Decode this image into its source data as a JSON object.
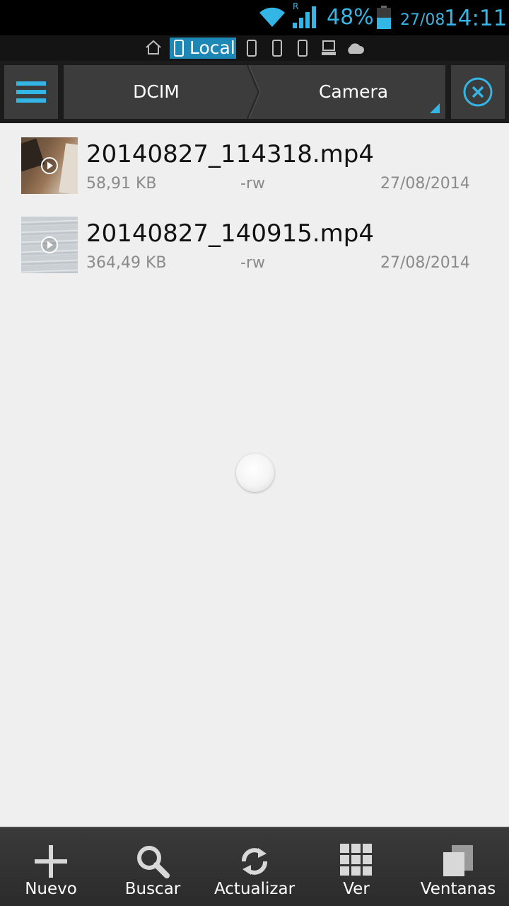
{
  "status_bar": {
    "battery_percent": "48%",
    "date": "27/08",
    "time": "14:11",
    "roaming_indicator": "R",
    "accent_color": "#33b5e5"
  },
  "location_strip": {
    "active_label": "Local",
    "icons": [
      "home-icon",
      "phone-icon",
      "phone-icon",
      "phone-icon",
      "phone-icon",
      "computer-icon",
      "cloud-icon"
    ]
  },
  "toolbar": {
    "breadcrumbs": [
      "DCIM",
      "Camera"
    ],
    "menu_icon": "hamburger-menu-icon",
    "close_icon": "close-circle-icon"
  },
  "files": [
    {
      "name": "20140827_114318.mp4",
      "size": "58,91 KB",
      "permissions": "-rw",
      "date": "27/08/2014"
    },
    {
      "name": "20140827_140915.mp4",
      "size": "364,49 KB",
      "permissions": "-rw",
      "date": "27/08/2014"
    }
  ],
  "bottom_bar": {
    "items": [
      {
        "label": "Nuevo",
        "icon": "plus-icon"
      },
      {
        "label": "Buscar",
        "icon": "search-icon"
      },
      {
        "label": "Actualizar",
        "icon": "refresh-icon"
      },
      {
        "label": "Ver",
        "icon": "grid-view-icon"
      },
      {
        "label": "Ventanas",
        "icon": "windows-icon"
      }
    ]
  }
}
